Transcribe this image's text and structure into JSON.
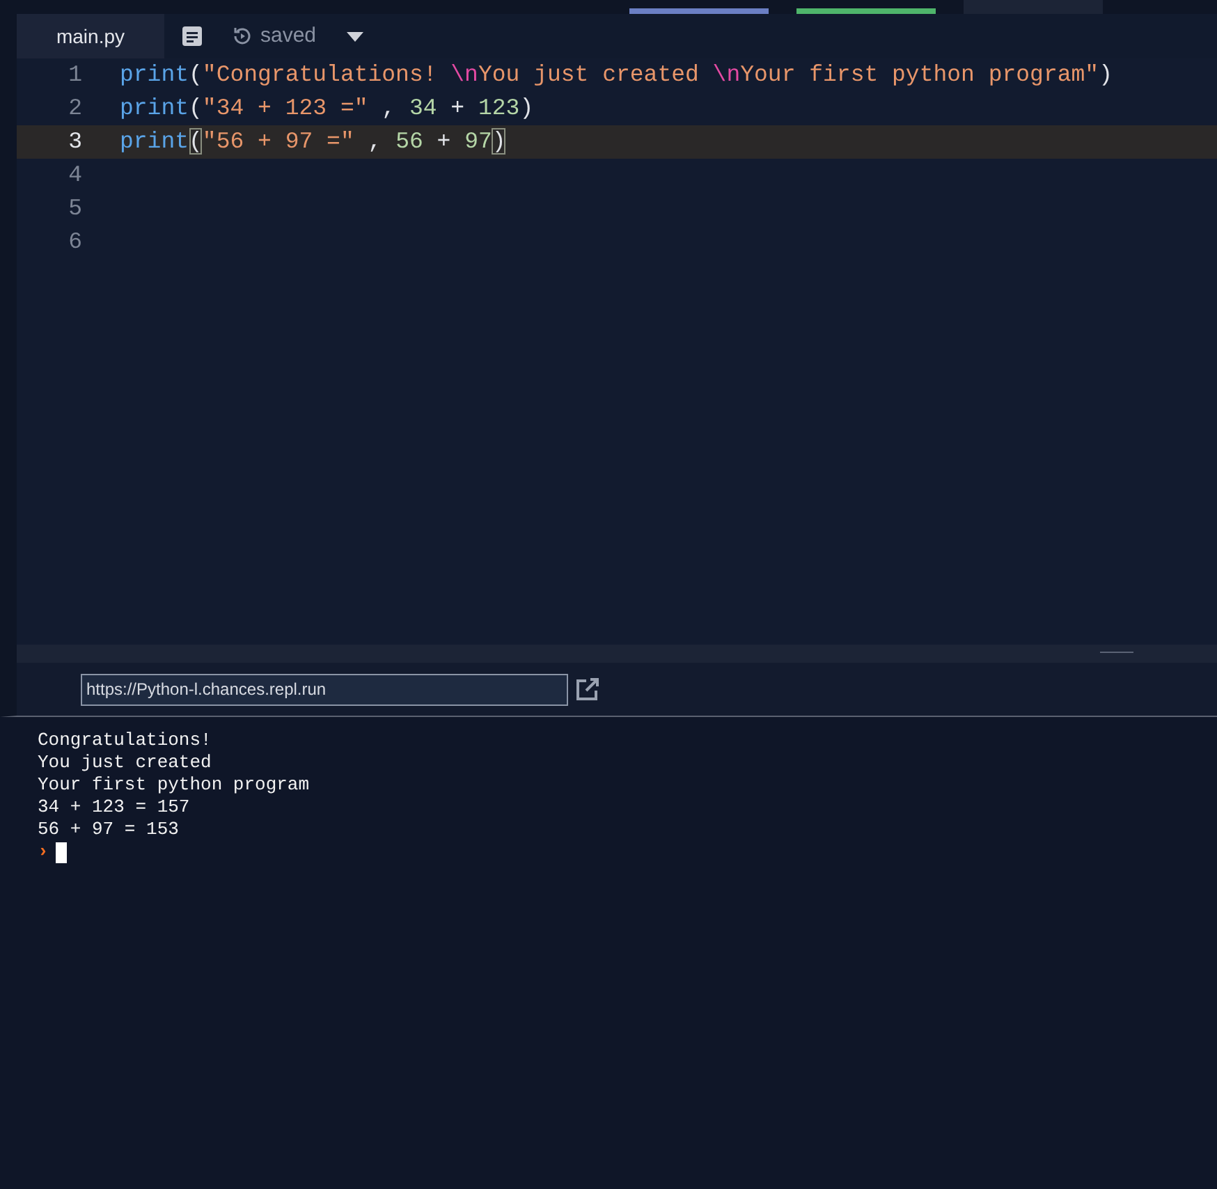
{
  "editor_tab": {
    "label": "main.py",
    "selected": true
  },
  "save_status": "saved",
  "code_lines": [
    {
      "number": "1",
      "selected": false,
      "tokens": [
        {
          "kind": "fn",
          "text": "print"
        },
        {
          "kind": "punc",
          "text": "("
        },
        {
          "kind": "str",
          "text": "\"Congratulations! "
        },
        {
          "kind": "esc",
          "text": "\\n"
        },
        {
          "kind": "str",
          "text": "You just created "
        },
        {
          "kind": "esc",
          "text": "\\n"
        },
        {
          "kind": "str",
          "text": "Your first python program\""
        },
        {
          "kind": "punc",
          "text": ")"
        }
      ]
    },
    {
      "number": "2",
      "selected": false,
      "tokens": [
        {
          "kind": "fn",
          "text": "print"
        },
        {
          "kind": "punc",
          "text": "("
        },
        {
          "kind": "str",
          "text": "\"34 + 123 =\""
        },
        {
          "kind": "punc",
          "text": " , "
        },
        {
          "kind": "num",
          "text": "34"
        },
        {
          "kind": "punc",
          "text": " + "
        },
        {
          "kind": "num",
          "text": "123"
        },
        {
          "kind": "punc",
          "text": ")"
        }
      ]
    },
    {
      "number": "3",
      "selected": true,
      "tokens": [
        {
          "kind": "fn",
          "text": "print"
        },
        {
          "kind": "punc",
          "text": "(",
          "bracket_match": true
        },
        {
          "kind": "str",
          "text": "\"56 + 97 =\""
        },
        {
          "kind": "punc",
          "text": " , "
        },
        {
          "kind": "num",
          "text": "56"
        },
        {
          "kind": "punc",
          "text": " + "
        },
        {
          "kind": "num",
          "text": "97"
        },
        {
          "kind": "punc",
          "text": ")",
          "bracket_match": true
        }
      ]
    },
    {
      "number": "4",
      "selected": false
    },
    {
      "number": "5",
      "selected": false
    },
    {
      "number": "6",
      "selected": false
    }
  ],
  "preview_url": "https://Python-l.chances.repl.run",
  "console_lines": [
    "Congratulations!",
    "You just created",
    "Your first python program",
    "34 + 123 = 157",
    "56 + 97 = 153"
  ],
  "prompt": "›"
}
